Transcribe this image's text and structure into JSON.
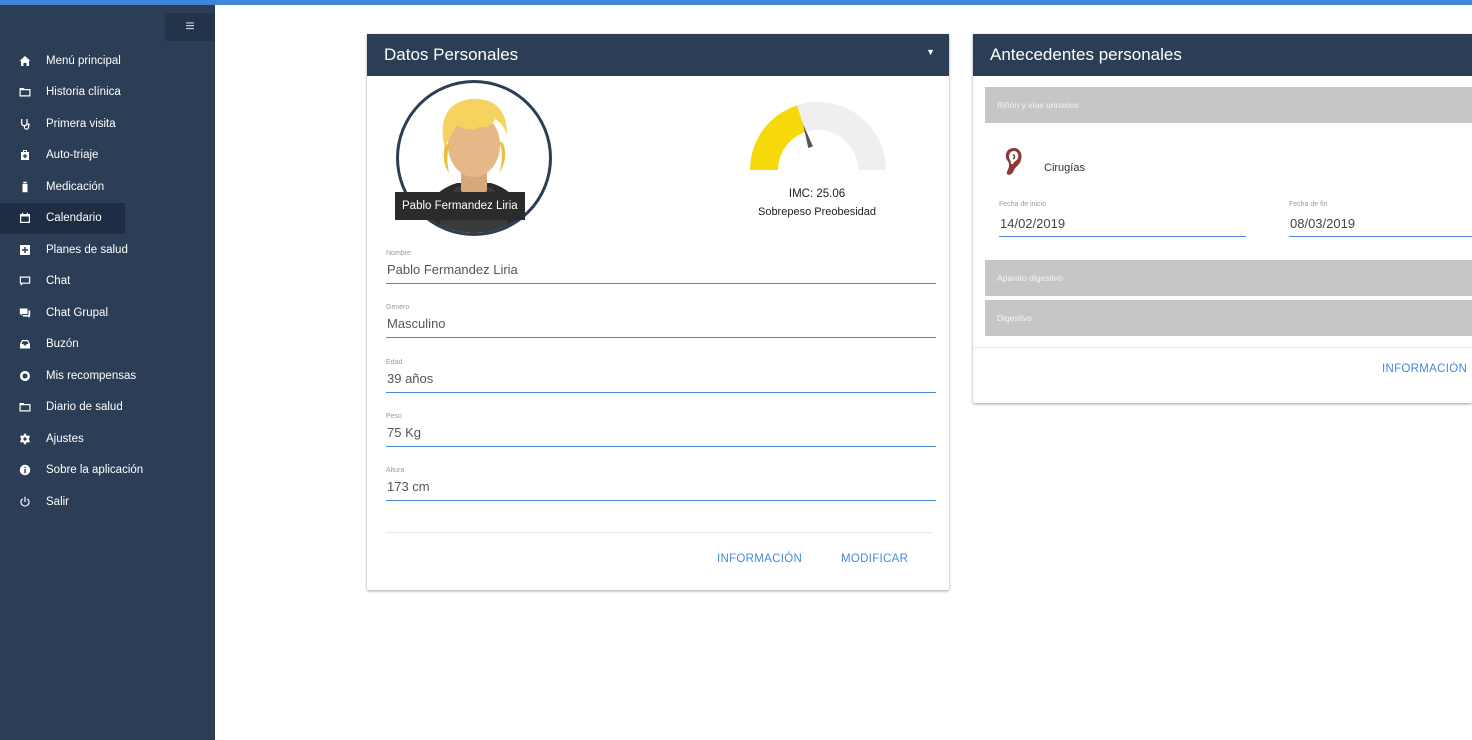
{
  "sidebar": {
    "toggle_glyph": "≡",
    "items": [
      {
        "label": "Menú principal",
        "icon": "home-icon"
      },
      {
        "label": "Historia clínica",
        "icon": "folder-icon"
      },
      {
        "label": "Primera visita",
        "icon": "stethoscope-icon"
      },
      {
        "label": "Auto-triaje",
        "icon": "medkit-icon"
      },
      {
        "label": "Medicación",
        "icon": "bottle-icon"
      },
      {
        "label": "Calendario",
        "icon": "calendar-icon",
        "active": true
      },
      {
        "label": "Planes de salud",
        "icon": "plus-box-icon"
      },
      {
        "label": "Chat",
        "icon": "chat-icon"
      },
      {
        "label": "Chat Grupal",
        "icon": "group-chat-icon"
      },
      {
        "label": "Buzón",
        "icon": "inbox-icon"
      },
      {
        "label": "Mis recompensas",
        "icon": "reward-icon"
      },
      {
        "label": "Diario de salud",
        "icon": "folder-icon"
      },
      {
        "label": "Ajustes",
        "icon": "gear-icon"
      },
      {
        "label": "Sobre la aplicación",
        "icon": "info-icon"
      },
      {
        "label": "Salir",
        "icon": "power-icon"
      }
    ]
  },
  "personal": {
    "title": "Datos Personales",
    "name_badge": "Pablo Fermandez Liria",
    "imc_value": "IMC: 25.06",
    "imc_label": "Sobrepeso Preobesidad",
    "imc_fraction": 0.4,
    "fields": [
      {
        "label": "Nombre",
        "value": "Pablo Fermandez Liria"
      },
      {
        "label": "Genero",
        "value": "Masculino"
      },
      {
        "label": "Edad",
        "value": "39 años"
      },
      {
        "label": "Peso",
        "value": "75 Kg"
      },
      {
        "label": "Altura",
        "value": "173 cm"
      }
    ],
    "btn_info": "INFORMACIÓN",
    "btn_modify": "MODIFICAR"
  },
  "antecedentes": {
    "title": "Antecedentes personales",
    "section1": "Riñón y vías urinarios",
    "cirugias": "Cirugías",
    "start_label": "Fecha de inicio",
    "start_value": "14/02/2019",
    "end_label": "Fecha de fin",
    "end_value": "08/03/2019",
    "section2": "Aparato digestivo",
    "section3": "Digestivo",
    "btn_info": "INFORMACIÓN"
  },
  "colors": {
    "sidebar_bg": "#2c3e55",
    "accent": "#4a88d8",
    "gauge_fill": "#f5d90a"
  }
}
